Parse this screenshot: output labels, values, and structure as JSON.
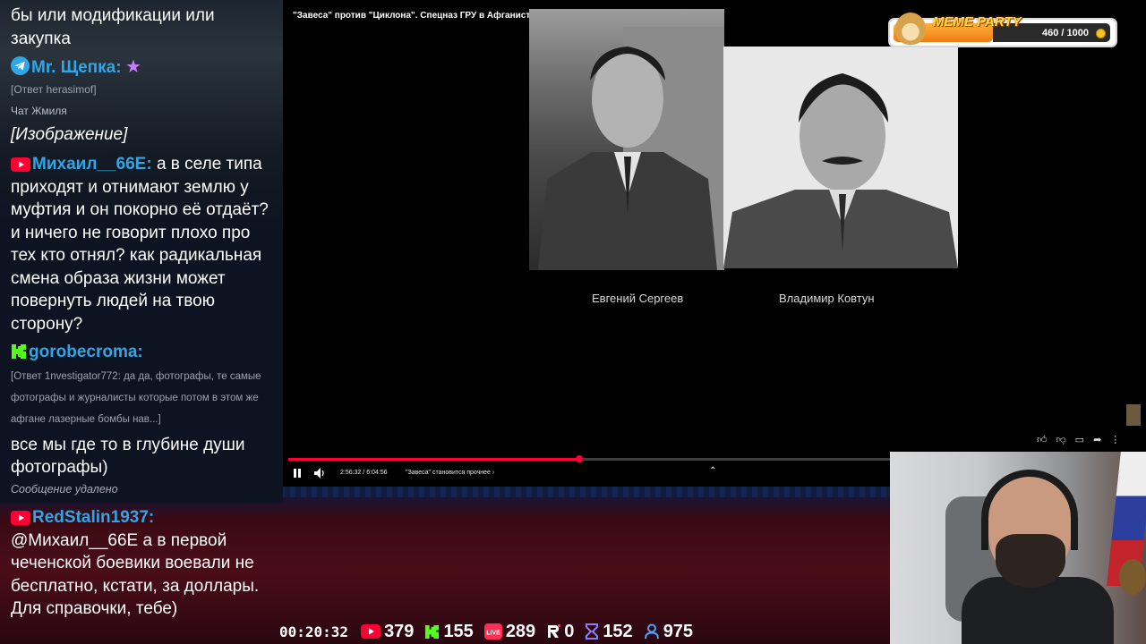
{
  "chat": {
    "messages": [
      {
        "text": "бы или модификации или закупка"
      },
      {
        "platform": "telegram",
        "nick": "Mr. Щепка:",
        "nick_color": "#2ea6e8",
        "reply": "[Ответ herasimof]",
        "chat_name": "Чат Жмиля",
        "text": "[Изображение]"
      },
      {
        "platform": "youtube",
        "nick": "Михаил__66E:",
        "nick_color": "#2ea6e8",
        "text": "а в селе типа приходят и отнимают землю у муфтия и он покорно её отдаёт? и ничего не говорит плохо про тех кто отнял? как радикальная смена образа жизни может повернуть людей на твою сторону?"
      },
      {
        "platform": "kick",
        "nick": "gorobecroma:",
        "nick_color": "#2ea6e8",
        "reply": "[Ответ 1nvestigator772: да да, фотографы, те самые фотографы и журналисты которые потом в этом же афгане лазерные бомбы нав...]",
        "text": "все мы где то в глубине души фотографы)"
      },
      {
        "deleted": "Сообщение удалено"
      },
      {
        "platform": "youtube",
        "nick": "RedStalin1937:",
        "nick_color": "#2ea6e8",
        "text": "@Михаил__66E а в первой чеченской боевики воевали не бесплатно, кстати, за доллары. Для справочки, тебе)"
      }
    ]
  },
  "video": {
    "title": "\"Завеса\" против \"Циклона\". Спецназ ГРУ в Афганистане",
    "captions": [
      "Евгений Сергеев",
      "Владимир Ковтун"
    ],
    "time": "2:56:32 / 6:04:56",
    "chapter": "\"Завеса\" становится прочнее",
    "progress": 0.4838
  },
  "meme_party": {
    "title": "MEME PARTY",
    "count": "460 / 1000",
    "progress": 0.46
  },
  "stats": {
    "uptime": "00:20:32",
    "youtube": "379",
    "kick": "155",
    "vk_live": "289",
    "rutube": "0",
    "trovo": "152",
    "total": "975"
  },
  "colors": {
    "youtube_red": "#ff0033",
    "kick_green": "#53fc18",
    "telegram_blue": "#2ea6e8",
    "viewer_blue": "#4aa3ff"
  }
}
